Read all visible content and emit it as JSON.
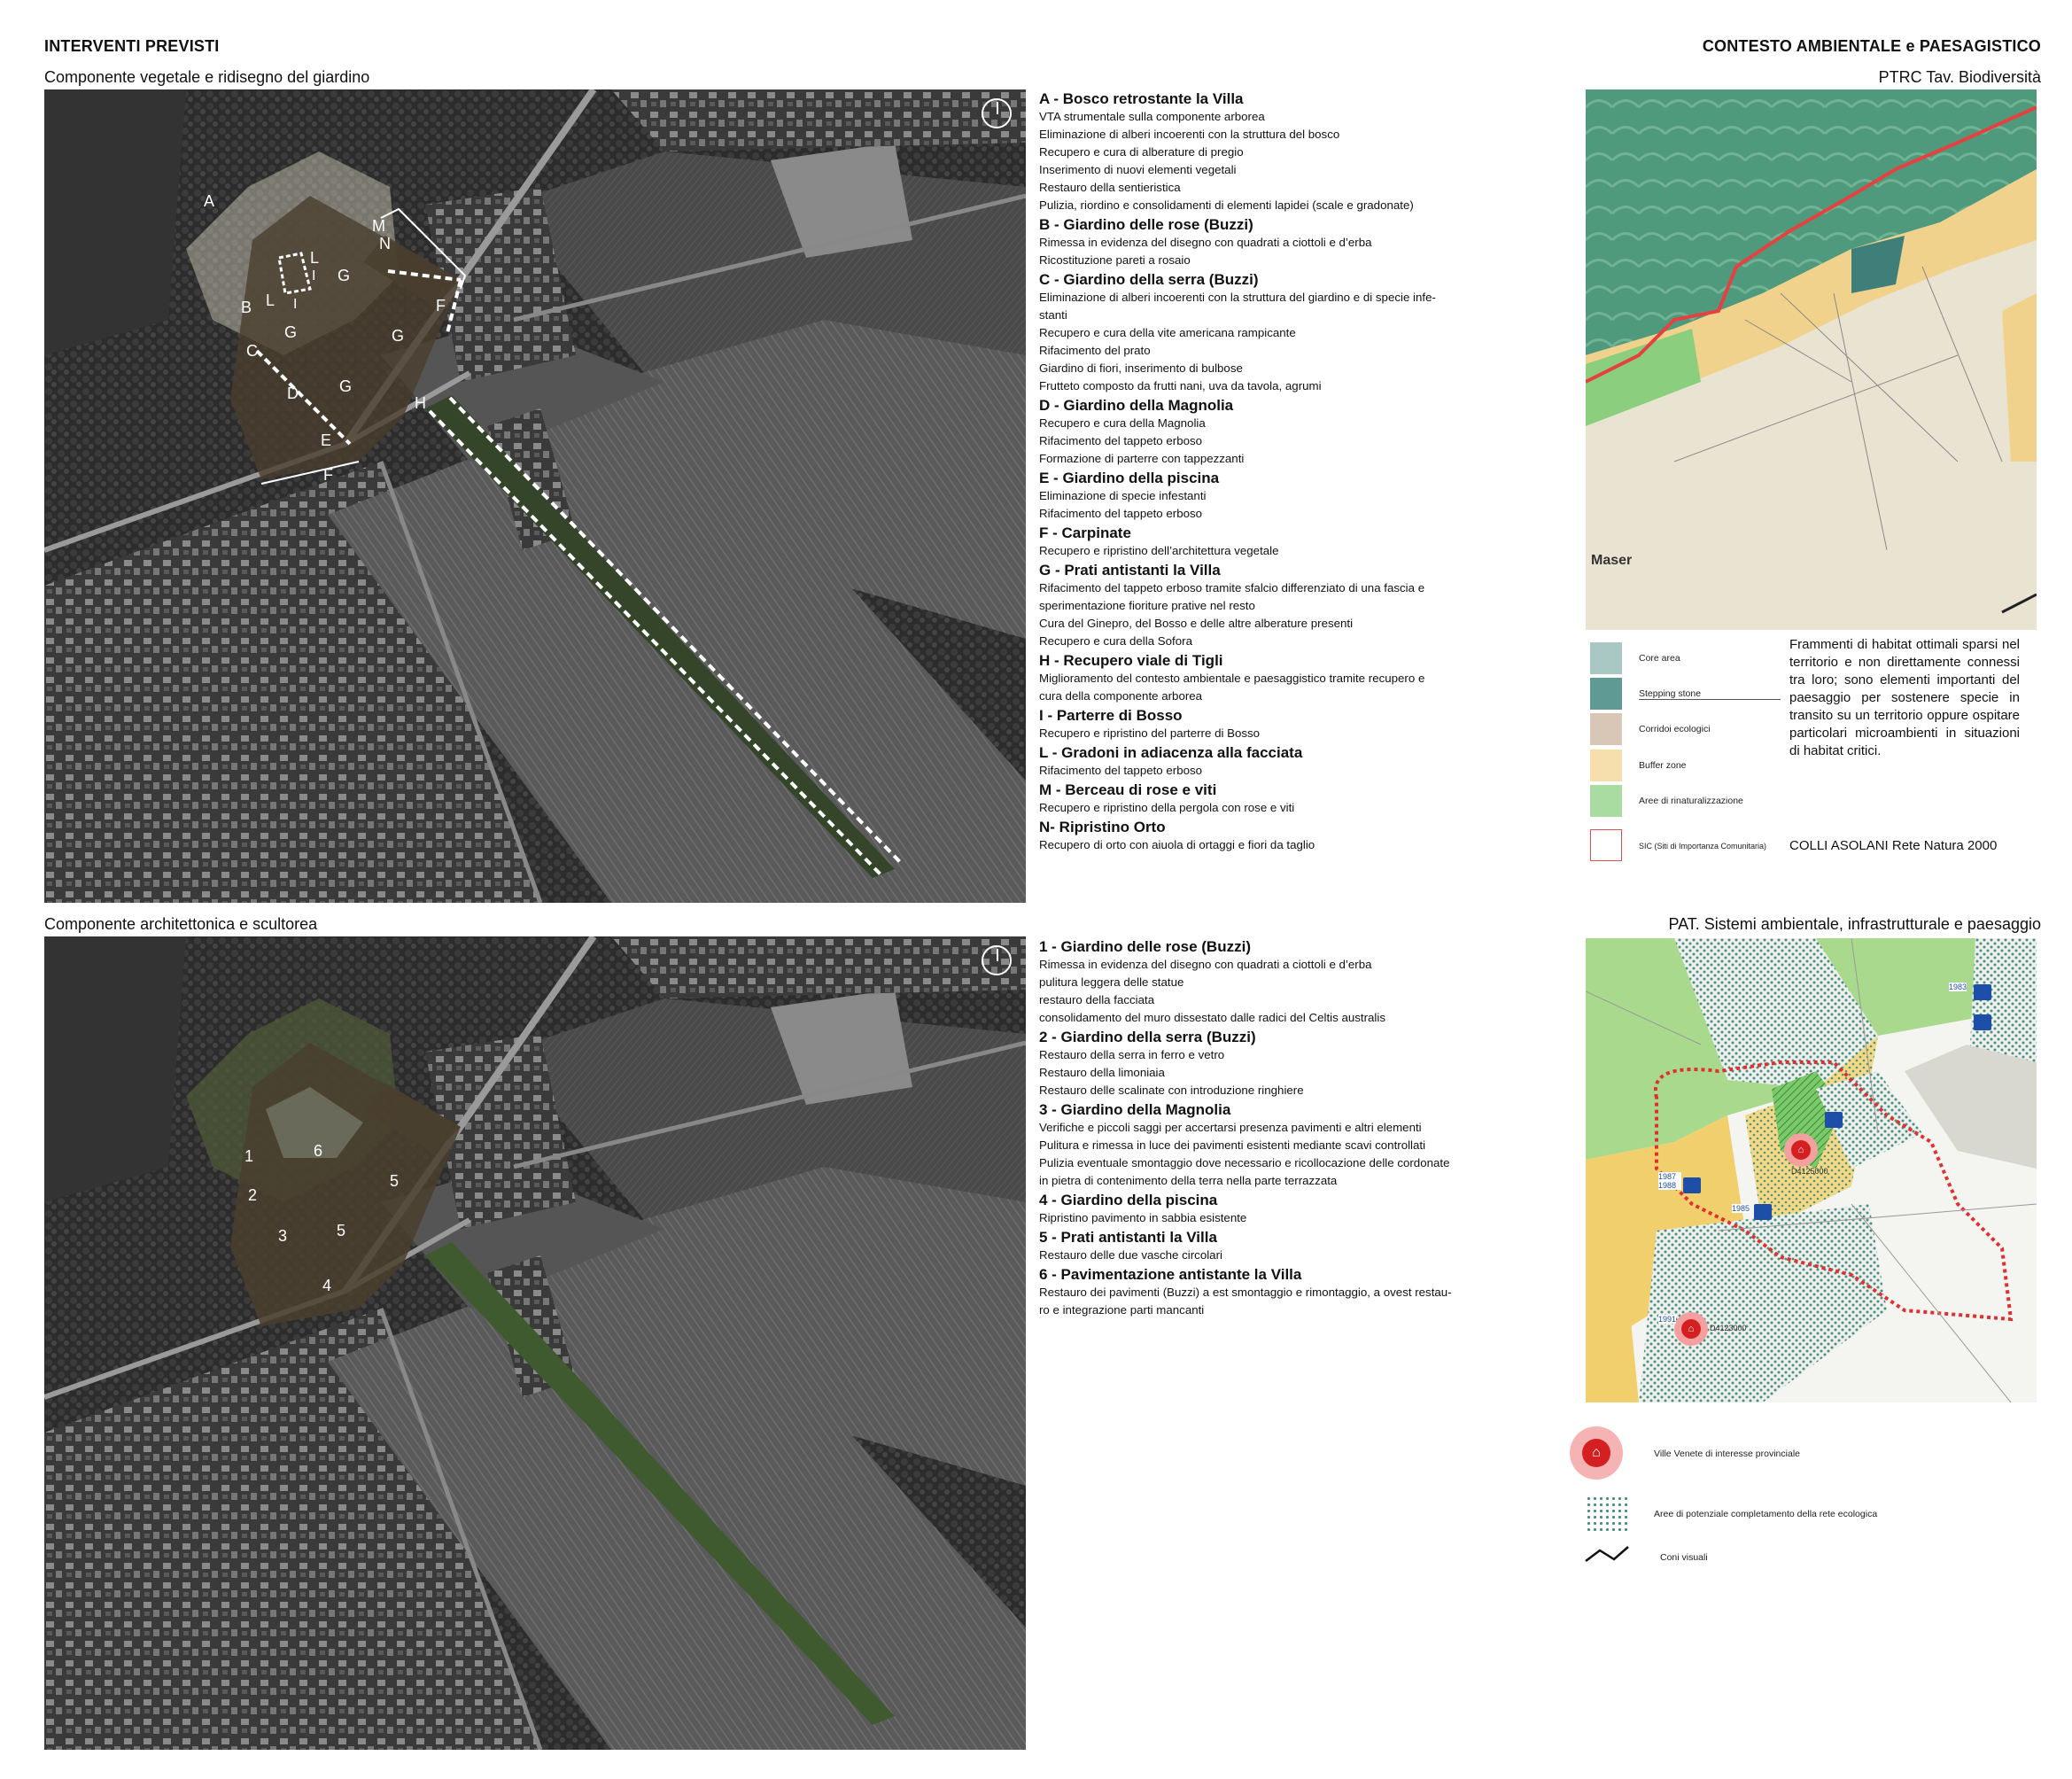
{
  "header": {
    "left_title": "INTERVENTI PREVISTI",
    "right_title": "CONTESTO AMBIENTALE e PAESAGISTICO"
  },
  "section1": {
    "subtitle": "Componente vegetale e ridisegno del giardino",
    "map_labels": [
      "A",
      "M",
      "N",
      "L",
      "G",
      "I",
      "B",
      "L",
      "I",
      "F",
      "G",
      "G",
      "C",
      "G",
      "D",
      "H",
      "E",
      "F"
    ],
    "list": [
      {
        "title": "A - Bosco retrostante la Villa",
        "lines": [
          "VTA strumentale sulla componente arborea",
          "Eliminazione di alberi incoerenti con la struttura del bosco",
          "Recupero e cura di alberature di pregio",
          "Inserimento di nuovi elementi vegetali",
          "Restauro della sentieristica",
          "Pulizia, riordino e consolidamenti di elementi lapidei (scale e gradonate)"
        ]
      },
      {
        "title": "B - Giardino delle rose (Buzzi)",
        "lines": [
          "Rimessa in evidenza del disegno con quadrati a ciottoli e d’erba",
          "Ricostituzione pareti a rosaio"
        ]
      },
      {
        "title": "C - Giardino della serra (Buzzi)",
        "lines": [
          "Eliminazione di alberi incoerenti con la struttura del giardino e di specie infe-",
          "stanti",
          "Recupero e cura della vite americana rampicante",
          "Rifacimento del prato",
          "Giardino di fiori, inserimento di bulbose",
          "Frutteto composto da frutti nani, uva da tavola, agrumi"
        ]
      },
      {
        "title": "D - Giardino della Magnolia",
        "lines": [
          "Recupero e cura della Magnolia",
          "Rifacimento del tappeto erboso",
          "Formazione di parterre con tappezzanti"
        ]
      },
      {
        "title": "E - Giardino della piscina",
        "lines": [
          "Eliminazione di specie infestanti",
          "Rifacimento del tappeto erboso"
        ]
      },
      {
        "title": "F - Carpinate",
        "lines": [
          "Recupero e ripristino dell’architettura vegetale"
        ]
      },
      {
        "title": "G - Prati antistanti la Villa",
        "lines": [
          "Rifacimento del tappeto erboso tramite sfalcio differenziato di una fascia e",
          "sperimentazione fioriture prative nel resto",
          "Cura del Ginepro, del Bosso e delle altre alberature presenti",
          "Recupero e cura della Sofora"
        ]
      },
      {
        "title": "H - Recupero viale di Tigli",
        "lines": [
          "Miglioramento del contesto ambientale e paesaggistico tramite recupero e",
          "cura della componente arborea"
        ]
      },
      {
        "title": "I - Parterre  di Bosso",
        "lines": [
          "Recupero e ripristino del parterre di Bosso"
        ]
      },
      {
        "title": "L - Gradoni in adiacenza alla facciata",
        "lines": [
          "Rifacimento del tappeto erboso"
        ]
      },
      {
        "title": "M - Berceau di rose e viti",
        "lines": [
          "Recupero e ripristino della pergola con rose e viti"
        ]
      },
      {
        "title": "N- Ripristino Orto",
        "lines": [
          "Recupero di orto con aiuola di ortaggi e fiori da taglio"
        ]
      }
    ]
  },
  "section2": {
    "subtitle": "Componente architettonica e scultorea",
    "map_labels": [
      "1",
      "6",
      "5",
      "2",
      "5",
      "3",
      "4"
    ],
    "list": [
      {
        "title": "1 - Giardino delle rose (Buzzi)",
        "lines": [
          "Rimessa in evidenza del disegno con quadrati a ciottoli e d’erba",
          "pulitura leggera delle statue",
          "restauro della facciata",
          "consolidamento del muro dissestato dalle radici del Celtis australis"
        ]
      },
      {
        "title": "2 - Giardino della serra (Buzzi)",
        "lines": [
          "Restauro della serra in ferro e vetro",
          "Restauro della limoniaia",
          "Restauro delle scalinate con introduzione ringhiere"
        ]
      },
      {
        "title": "3 - Giardino della Magnolia",
        "lines": [
          "Verifiche e piccoli saggi per accertarsi presenza pavimenti e altri elementi",
          "Pulitura e rimessa in luce dei pavimenti esistenti mediante scavi controllati",
          "Pulizia eventuale smontaggio dove necessario e ricollocazione delle cordonate",
          "in pietra di contenimento della terra  nella parte terrazzata"
        ]
      },
      {
        "title": "4 - Giardino della piscina",
        "lines": [
          "Ripristino pavimento in sabbia esistente"
        ]
      },
      {
        "title": "5 - Prati antistanti la Villa",
        "lines": [
          "Restauro delle due vasche circolari"
        ]
      },
      {
        "title": "6 - Pavimentazione antistante la Villa",
        "lines": [
          "Restauro dei pavimenti (Buzzi) a est smontaggio e rimontaggio, a ovest restau-",
          "ro e integrazione parti mancanti"
        ]
      }
    ]
  },
  "ptrc": {
    "title": "PTRC Tav. Biodiversità",
    "map_labels": {
      "town": "Maser"
    },
    "legend": [
      {
        "label": "Core area",
        "color": "#a9c8c4"
      },
      {
        "label": "Stepping stone",
        "color": "#5f9a95"
      },
      {
        "label": "Corridoi ecologici",
        "color": "#d8c6b6"
      },
      {
        "label": "Buffer zone",
        "color": "#f7dfad"
      },
      {
        "label": "Aree di rinaturalizzazione",
        "color": "#a8dca0"
      },
      {
        "label": "SIC (Siti di Importanza Comunitaria)",
        "color": "#ffffff"
      }
    ],
    "note": "Frammenti di habitat ottimali sparsi nel territorio e non direttamente connessi tra loro; sono elementi importanti del paesaggio per sostenere specie in transito su un territorio oppure ospitare particolari microambienti in situazioni di habitat critici.",
    "natura": "COLLI ASOLANI Rete Natura 2000"
  },
  "pat": {
    "title": "PAT. Sistemi ambientale, infrastrutturale e paesaggio",
    "map_labels": [
      "1983",
      "D4125000",
      "1987 1988",
      "1985",
      "1991",
      "D4123000"
    ],
    "legend": [
      {
        "label": "Ville Venete di interesse provinciale",
        "icon": "villa-icon"
      },
      {
        "label": "Aree di potenziale completamento della rete ecologica",
        "icon": "dotted-area-icon"
      },
      {
        "label": "Coni visuali",
        "icon": "view-cone-icon"
      }
    ]
  }
}
